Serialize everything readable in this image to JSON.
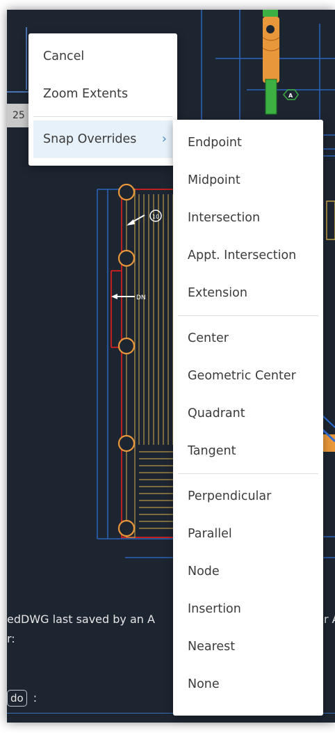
{
  "canvas": {
    "background": "#1d2531",
    "coordinate_readout": "25",
    "annotations": {
      "tag_a": "A",
      "tag_10": "10",
      "dn_label": "DN"
    }
  },
  "command_line": {
    "line1": "edDWG last saved by an A",
    "line1_tail": "r A",
    "line2": "r:",
    "key_label": "do",
    "line3_suffix": ":"
  },
  "context_menu": {
    "items": [
      "Cancel",
      "Zoom Extents"
    ],
    "submenu_trigger": "Snap Overrides",
    "chevron": "chevron-right-icon"
  },
  "snap_menu": {
    "groups": [
      [
        "Endpoint",
        "Midpoint",
        "Intersection",
        "Appt. Intersection",
        "Extension"
      ],
      [
        "Center",
        "Geometric Center",
        "Quadrant",
        "Tangent"
      ],
      [
        "Perpendicular",
        "Parallel",
        "Node",
        "Insertion",
        "Nearest",
        "None"
      ]
    ]
  },
  "colors": {
    "accent": "#4a89c5",
    "highlight": "#e7f1fa",
    "cad_blue": "#2f6fd6",
    "cad_orange": "#e8973a",
    "cad_red": "#c02020",
    "cad_yellow": "#c9a64a",
    "cad_green": "#3cb043"
  }
}
